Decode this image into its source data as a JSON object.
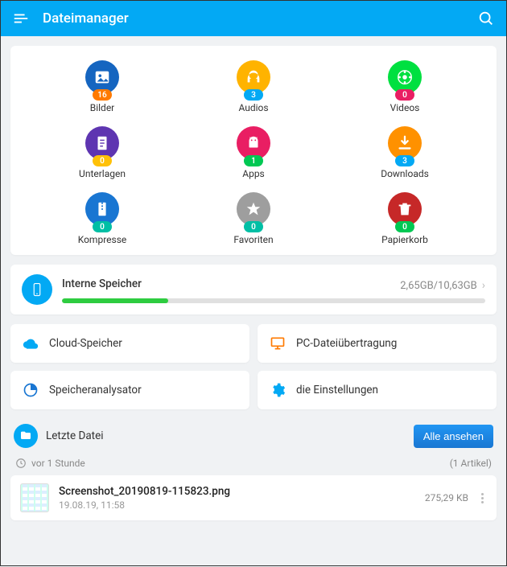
{
  "app": {
    "title": "Dateimanager"
  },
  "categories": [
    {
      "label": "Bilder",
      "count": 16,
      "color": "#1565C0",
      "badge_color": "#FF7A00",
      "icon": "image"
    },
    {
      "label": "Audios",
      "count": 3,
      "color": "#FFB300",
      "badge_color": "#03A9F4",
      "icon": "headphones"
    },
    {
      "label": "Videos",
      "count": 0,
      "color": "#00E040",
      "badge_color": "#E91E63",
      "icon": "video"
    },
    {
      "label": "Unterlagen",
      "count": 0,
      "color": "#5E35B1",
      "badge_color": "#FFC107",
      "icon": "document"
    },
    {
      "label": "Apps",
      "count": 1,
      "color": "#E91E63",
      "badge_color": "#00C853",
      "icon": "android"
    },
    {
      "label": "Downloads",
      "count": 3,
      "color": "#FF9100",
      "badge_color": "#03A9F4",
      "icon": "download"
    },
    {
      "label": "Kompresse",
      "count": 0,
      "color": "#1976D2",
      "badge_color": "#00BFA5",
      "icon": "zip"
    },
    {
      "label": "Favoriten",
      "count": 0,
      "color": "#9E9E9E",
      "badge_color": "#00BFA5",
      "icon": "star"
    },
    {
      "label": "Papierkorb",
      "count": 0,
      "color": "#C62828",
      "badge_color": "#00C853",
      "icon": "trash"
    }
  ],
  "storage": {
    "title": "Interne Speicher",
    "used": "2,65GB",
    "total": "10,63GB",
    "display": "2,65GB/10,63GB",
    "percent": 25
  },
  "tools": {
    "cloud": "Cloud-Speicher",
    "pc": "PC-Dateiübertragung",
    "analyze": "Speicheranalysator",
    "settings": "die Einstellungen"
  },
  "recent": {
    "title": "Letzte Datei",
    "view_all": "Alle ansehen",
    "time": "vor 1 Stunde",
    "count_label": "(1 Artikel)",
    "file": {
      "name": "Screenshot_20190819-115823.png",
      "date": "19.08.19, 11:58",
      "size": "275,29 KB"
    }
  }
}
